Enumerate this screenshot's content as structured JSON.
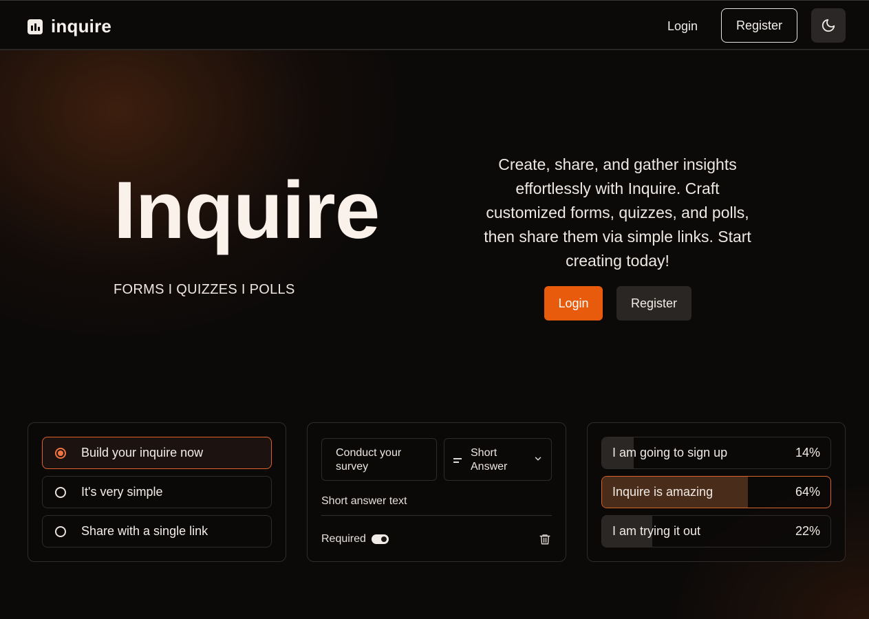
{
  "header": {
    "logo_text": "inquire",
    "login_label": "Login",
    "register_label": "Register",
    "theme_icon": "moon-icon"
  },
  "hero": {
    "title": "Inquire",
    "subtitle": "FORMS I QUIZZES I POLLS",
    "description": "Create, share, and gather insights effortlessly with Inquire. Craft customized forms, quizzes, and polls, then share them via simple links. Start creating today!",
    "login_label": "Login",
    "register_label": "Register"
  },
  "options_card": {
    "items": [
      {
        "label": "Build your inquire now",
        "selected": true
      },
      {
        "label": "It's very simple",
        "selected": false
      },
      {
        "label": "Share with a single link",
        "selected": false
      }
    ]
  },
  "form_card": {
    "question": "Conduct your survey",
    "type_label": "Short Answer",
    "answer_placeholder": "Short answer text",
    "required_label": "Required",
    "required_on": true
  },
  "poll_card": {
    "items": [
      {
        "label": "I am going to sign up",
        "percent": "14%",
        "value": 0.14,
        "selected": false
      },
      {
        "label": "Inquire is amazing",
        "percent": "64%",
        "value": 0.64,
        "selected": true
      },
      {
        "label": "I am trying it out",
        "percent": "22%",
        "value": 0.22,
        "selected": false
      }
    ]
  },
  "colors": {
    "accent": "#e85a0c",
    "background": "#0c0a09",
    "card_border": "#302c2a"
  }
}
